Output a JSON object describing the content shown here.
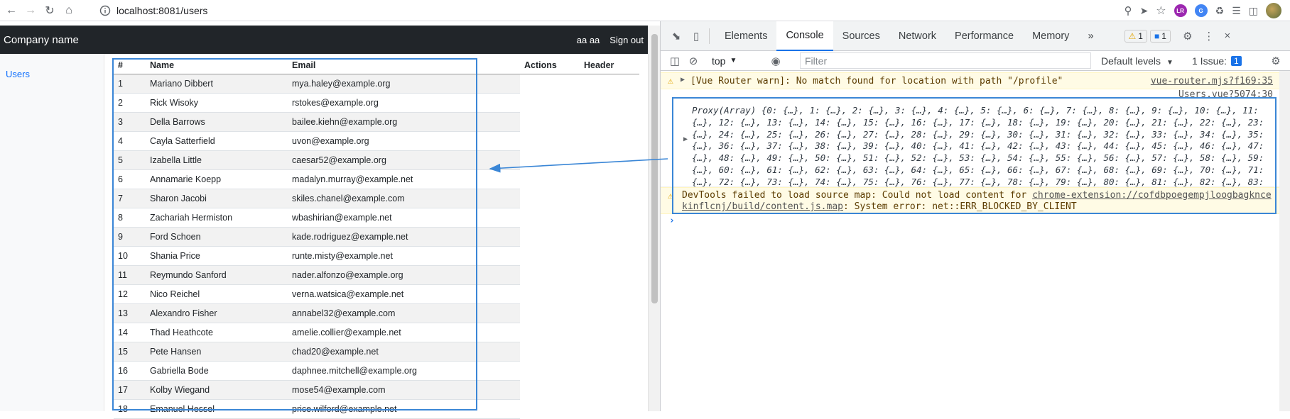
{
  "browser": {
    "url": "localhost:8081/users",
    "ext_badges": [
      "LR"
    ]
  },
  "app": {
    "brand": "Company name",
    "user": "aa aa",
    "sign_out": "Sign out",
    "sidebar_link": "Users"
  },
  "table": {
    "headers": [
      "#",
      "Name",
      "Email",
      "Actions",
      "Header"
    ],
    "rows": [
      {
        "n": "1",
        "name": "Mariano Dibbert",
        "email": "mya.haley@example.org"
      },
      {
        "n": "2",
        "name": "Rick Wisoky",
        "email": "rstokes@example.org"
      },
      {
        "n": "3",
        "name": "Della Barrows",
        "email": "bailee.kiehn@example.org"
      },
      {
        "n": "4",
        "name": "Cayla Satterfield",
        "email": "uvon@example.org"
      },
      {
        "n": "5",
        "name": "Izabella Little",
        "email": "caesar52@example.org"
      },
      {
        "n": "6",
        "name": "Annamarie Koepp",
        "email": "madalyn.murray@example.net"
      },
      {
        "n": "7",
        "name": "Sharon Jacobi",
        "email": "skiles.chanel@example.com"
      },
      {
        "n": "8",
        "name": "Zachariah Hermiston",
        "email": "wbashirian@example.net"
      },
      {
        "n": "9",
        "name": "Ford Schoen",
        "email": "kade.rodriguez@example.net"
      },
      {
        "n": "10",
        "name": "Shania Price",
        "email": "runte.misty@example.net"
      },
      {
        "n": "11",
        "name": "Reymundo Sanford",
        "email": "nader.alfonzo@example.org"
      },
      {
        "n": "12",
        "name": "Nico Reichel",
        "email": "verna.watsica@example.net"
      },
      {
        "n": "13",
        "name": "Alexandro Fisher",
        "email": "annabel32@example.com"
      },
      {
        "n": "14",
        "name": "Thad Heathcote",
        "email": "amelie.collier@example.net"
      },
      {
        "n": "15",
        "name": "Pete Hansen",
        "email": "chad20@example.net"
      },
      {
        "n": "16",
        "name": "Gabriella Bode",
        "email": "daphnee.mitchell@example.org"
      },
      {
        "n": "17",
        "name": "Kolby Wiegand",
        "email": "mose54@example.com"
      },
      {
        "n": "18",
        "name": "Emanuel Hessel",
        "email": "price.wilford@example.net"
      }
    ]
  },
  "devtools": {
    "tabs": [
      "Elements",
      "Console",
      "Sources",
      "Network",
      "Performance",
      "Memory"
    ],
    "active_tab": "Console",
    "more": "»",
    "warn_count": "1",
    "info_count": "1",
    "context": "top",
    "filter_placeholder": "Filter",
    "levels": "Default levels",
    "issues_label": "1 Issue:",
    "issues_count": "1",
    "msg1_text": "[Vue Router warn]: No match found for location with path \"/profile\"",
    "msg1_link": "vue-router.mjs?f169:35",
    "msg2_link": "Users.vue?5074:30",
    "proxy_prefix": "Proxy(Array) ",
    "msg3_text": "DevTools failed to load source map: Could not load content for ",
    "msg3_link": "chrome-extension://cofdbpoegempjloogbagkncekinflcnj/build/content.js.map",
    "msg3_suffix": ": System error: net::ERR_BLOCKED_BY_CLIENT",
    "prompt": "›"
  },
  "colors": {
    "navbar": "#212529",
    "accent": "#3a86d6",
    "link": "#0d6efd"
  }
}
